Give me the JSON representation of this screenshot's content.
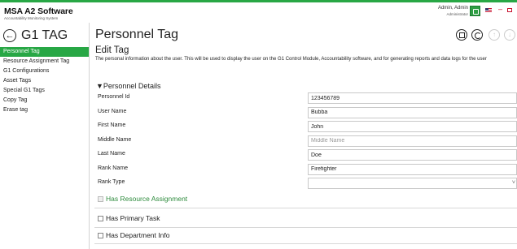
{
  "app": {
    "title": "MSA A2 Software",
    "subtitle": "Accountability Monitoring System"
  },
  "user": {
    "name": "Admin, Admin",
    "role": "Administrator"
  },
  "sidebar": {
    "title": "G1 TAG",
    "items": [
      {
        "label": "Personnel Tag",
        "active": true
      },
      {
        "label": "Resource Assignment Tag",
        "active": false
      },
      {
        "label": "G1 Configurations",
        "active": false
      },
      {
        "label": "Asset Tags",
        "active": false
      },
      {
        "label": "Special G1 Tags",
        "active": false
      },
      {
        "label": "Copy Tag",
        "active": false
      },
      {
        "label": "Erase tag",
        "active": false
      }
    ]
  },
  "main": {
    "title": "Personnel Tag",
    "section_title": "Edit Tag",
    "section_desc": "The personal information about the user.  This will be used to display the user on the G1 Control Module, Accountability software, and for generating reports and data logs for the user",
    "details_header": "▼Personnel Details",
    "fields": [
      {
        "label": "Personnel Id",
        "value": "123456789",
        "placeholder": ""
      },
      {
        "label": "User Name",
        "value": "Bubba",
        "placeholder": ""
      },
      {
        "label": "First Name",
        "value": "John",
        "placeholder": ""
      },
      {
        "label": "Middle Name",
        "value": "",
        "placeholder": "Middle Name"
      },
      {
        "label": "Last Name",
        "value": "Doe",
        "placeholder": ""
      },
      {
        "label": "Rank Name",
        "value": "Firefighter",
        "placeholder": ""
      }
    ],
    "rank_type": {
      "label": "Rank Type",
      "value": ""
    },
    "checkboxes": [
      {
        "label": "Has Resource Assignment",
        "checked": false,
        "disabled": true
      },
      {
        "label": "Has Primary Task",
        "checked": false,
        "disabled": false
      },
      {
        "label": "Has Department Info",
        "checked": false,
        "disabled": false
      }
    ]
  },
  "icons": {
    "back": "arrow-left-circle-icon",
    "save": "save-icon",
    "undo": "undo-icon",
    "move_up": "arrow-up-icon",
    "move_down": "arrow-down-icon",
    "status": "network-status-icon",
    "flag": "us-flag-icon"
  },
  "colors": {
    "accent": "#28a745",
    "active_nav_bg": "#28a745",
    "disabled_checkbox_label": "#2e8b3d"
  }
}
